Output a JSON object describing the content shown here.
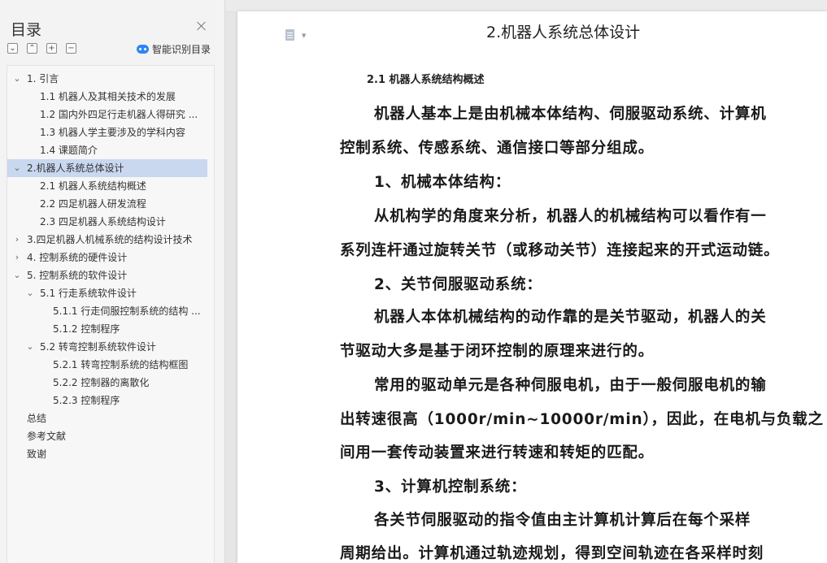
{
  "toc": {
    "title": "目录",
    "smart_toc_label": "智能识别目录",
    "tools": [
      "⌄",
      "⌃",
      "+",
      "−"
    ],
    "items": [
      {
        "label": "1. 引言",
        "toggle": "⌄"
      },
      {
        "label": "1.1 机器人及其相关技术的发展",
        "toggle": ""
      },
      {
        "label": "1.2 国内外四足行走机器人得研究 ...",
        "toggle": ""
      },
      {
        "label": "1.3 机器人学主要涉及的学科内容",
        "toggle": ""
      },
      {
        "label": "1.4  课题简介",
        "toggle": ""
      },
      {
        "label": "2.机器人系统总体设计",
        "toggle": "⌄"
      },
      {
        "label": "2.1 机器人系统结构概述",
        "toggle": ""
      },
      {
        "label": "2.2  四足机器人研发流程",
        "toggle": ""
      },
      {
        "label": "2.3 四足机器人系统结构设计",
        "toggle": ""
      },
      {
        "label": "3.四足机器人机械系统的结构设计技术",
        "toggle": "›"
      },
      {
        "label": "4. 控制系统的硬件设计",
        "toggle": "›"
      },
      {
        "label": "5. 控制系统的软件设计",
        "toggle": "⌄"
      },
      {
        "label": "5.1  行走系统软件设计",
        "toggle": "⌄"
      },
      {
        "label": "5.1.1    行走伺服控制系统的结构 ...",
        "toggle": ""
      },
      {
        "label": "5.1.2 控制程序",
        "toggle": ""
      },
      {
        "label": "5.2 转弯控制系统软件设计",
        "toggle": "⌄"
      },
      {
        "label": "5.2.1 转弯控制系统的结构框图",
        "toggle": ""
      },
      {
        "label": "5.2.2  控制器的离散化",
        "toggle": ""
      },
      {
        "label": "5.2.3  控制程序",
        "toggle": ""
      },
      {
        "label": "总结",
        "toggle": ""
      },
      {
        "label": "参考文献",
        "toggle": ""
      },
      {
        "label": "致谢",
        "toggle": ""
      }
    ]
  },
  "document": {
    "title": "2.机器人系统总体设计",
    "section_heading": "2.1 机器人系统结构概述",
    "lines": [
      "机器人基本上是由机械本体结构、伺服驱动系统、计算机",
      "控制系统、传感系统、通信接口等部分组成。",
      "1、机械本体结构：",
      "从机构学的角度来分析，机器人的机械结构可以看作有一",
      "系列连杆通过旋转关节（或移动关节）连接起来的开式运动链。",
      "2、关节伺服驱动系统：",
      "机器人本体机械结构的动作靠的是关节驱动，机器人的关",
      "节驱动大多是基于闭环控制的原理来进行的。",
      "常用的驱动单元是各种伺服电机，由于一般伺服电机的输",
      "出转速很高（1000r/min~10000r/min），因此，在电机与负载之",
      "间用一套传动装置来进行转速和转矩的匹配。",
      "3、计算机控制系统：",
      "各关节伺服驱动的指令值由主计算机计算后在每个采样",
      "周期给出。计算机通过轨迹规划，得到空间轨迹在各采样时刻"
    ]
  }
}
